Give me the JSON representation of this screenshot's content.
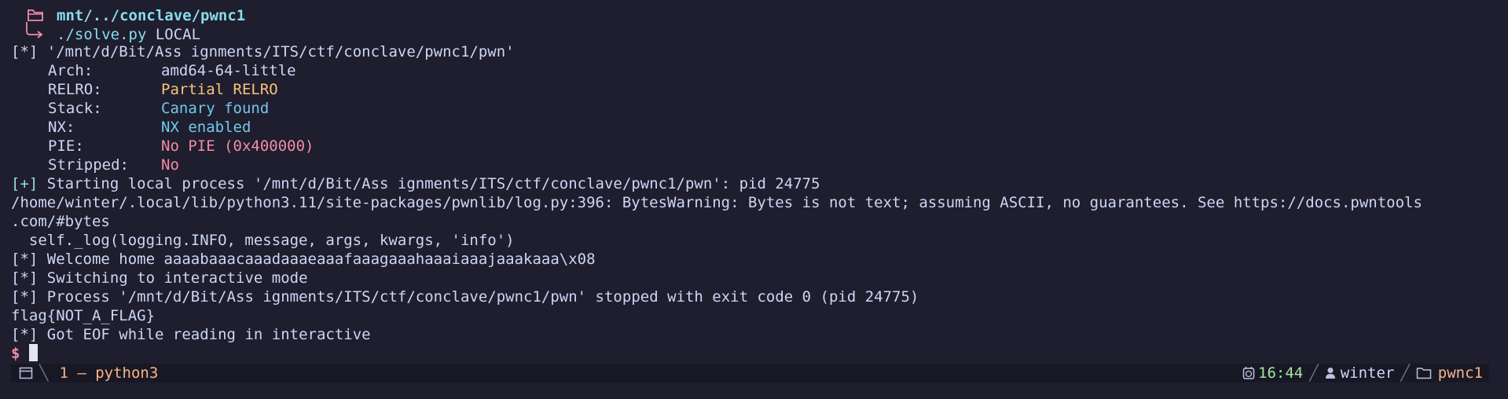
{
  "prompt": {
    "cwd": "mnt/../conclave/pwnc1",
    "command_exe": "./solve.py",
    "command_arg": "LOCAL"
  },
  "output": {
    "l1": {
      "tag": "[*]",
      "text": "'/mnt/d/Bit/Ass ignments/ITS/ctf/conclave/pwnc1/pwn'"
    },
    "checksec": [
      {
        "key": "Arch:",
        "value": "amd64-64-little",
        "color": "plain"
      },
      {
        "key": "RELRO:",
        "value": "Partial RELRO",
        "color": "yellow"
      },
      {
        "key": "Stack:",
        "value": "Canary found",
        "color": "cyan"
      },
      {
        "key": "NX:",
        "value": "NX enabled",
        "color": "cyan"
      },
      {
        "key": "PIE:",
        "value": "No PIE (0x400000)",
        "color": "red"
      },
      {
        "key": "Stripped:",
        "value": "No",
        "color": "red"
      }
    ],
    "l8": {
      "tag": "[+]",
      "text": "Starting local process '/mnt/d/Bit/Ass ignments/ITS/ctf/conclave/pwnc1/pwn': pid 24775"
    },
    "l9": "/home/winter/.local/lib/python3.11/site-packages/pwnlib/log.py:396: BytesWarning: Bytes is not text; assuming ASCII, no guarantees. See https://docs.pwntools",
    "l10": ".com/#bytes",
    "l11": "  self._log(logging.INFO, message, args, kwargs, 'info')",
    "l12": {
      "tag": "[*]",
      "text": "Welcome home aaaabaaacaaadaaaeaaafaaagaaahaaaiaaajaaakaaa\\x08"
    },
    "l13": {
      "tag": "[*]",
      "text": "Switching to interactive mode"
    },
    "l14": {
      "tag": "[*]",
      "text": "Process '/mnt/d/Bit/Ass ignments/ITS/ctf/conclave/pwnc1/pwn' stopped with exit code 0 (pid 24775)"
    },
    "l15": "flag{NOT_A_FLAG}",
    "l16": {
      "tag": "[*]",
      "text": "Got EOF while reading in interactive"
    },
    "shell_prompt": "$"
  },
  "statusbar": {
    "window": "1 – python3",
    "time": "16:44",
    "user": "winter",
    "session": "pwnc1"
  },
  "colors": {
    "background": "#1e1e2e",
    "cyan": "#89dceb",
    "yellow": "#f9c27a",
    "red": "#f38ba8",
    "orange": "#fab387",
    "green": "#a6e3a1"
  }
}
